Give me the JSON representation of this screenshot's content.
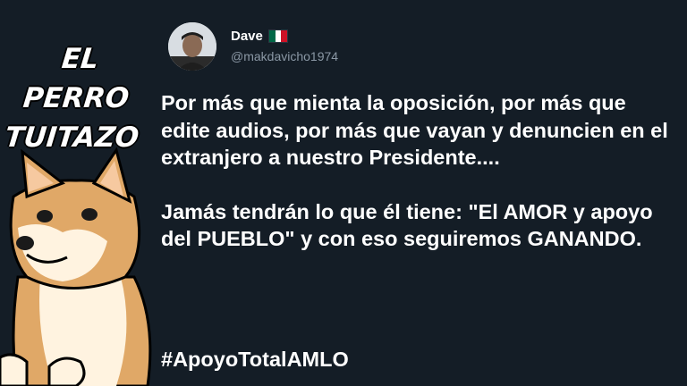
{
  "branding": {
    "line1": "EL PERRO",
    "line2": "TUITAZO"
  },
  "tweet": {
    "author_name": "Dave",
    "author_flag_icon": "mexico-flag-icon",
    "author_handle": "@makdavicho1974",
    "paragraph1": "Por más que mienta la oposición, por más que edite audios, por más que vayan y denuncien en el extranjero a nuestro Presidente....",
    "paragraph2": "Jamás tendrán lo que él tiene: \"El AMOR y apoyo del PUEBLO\" y con eso seguiremos GANANDO.",
    "hashtag": "#ApoyoTotalAMLO"
  },
  "colors": {
    "background": "#141d26",
    "text": "#ffffff",
    "handle": "#8b98a5",
    "dog_fur": "#e0a867"
  }
}
